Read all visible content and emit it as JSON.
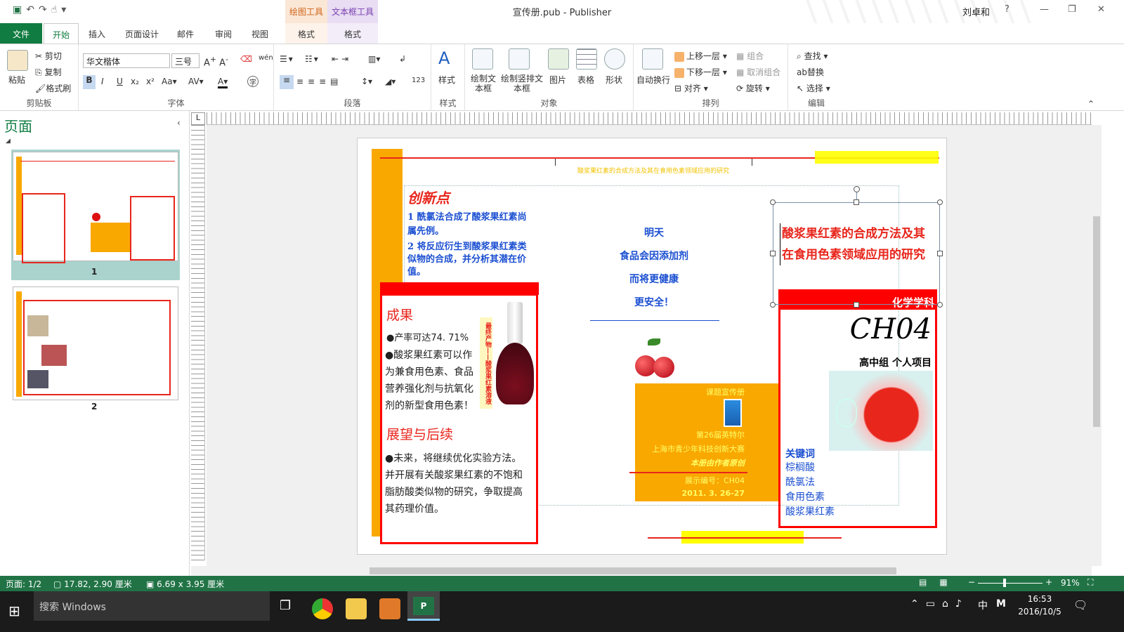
{
  "window": {
    "title": "宣传册.pub - Publisher",
    "user": "刘卓和",
    "help": "?"
  },
  "context_tabs": {
    "drawing_tools": "绘图工具",
    "textbox_tools": "文本框工具"
  },
  "tabs": [
    "文件",
    "开始",
    "插入",
    "页面设计",
    "邮件",
    "审阅",
    "视图",
    "格式",
    "格式"
  ],
  "ribbon": {
    "clipboard": {
      "label": "剪贴板",
      "paste": "粘贴",
      "cut": "剪切",
      "copy": "复制",
      "format_painter": "格式刷"
    },
    "font": {
      "label": "字体",
      "font_name": "华文楷体",
      "font_size": "三号"
    },
    "paragraph": {
      "label": "段落"
    },
    "styles": {
      "label": "样式",
      "styles_btn": "样式"
    },
    "objects": {
      "label": "对象",
      "draw_textbox": "绘制文本框",
      "draw_vtextbox": "绘制竖排文本框",
      "picture": "图片",
      "table": "表格",
      "shape": "形状"
    },
    "arrange": {
      "label": "排列",
      "wrap": "自动换行",
      "bring_forward": "上移一层",
      "send_backward": "下移一层",
      "align": "对齐",
      "group": "组合",
      "ungroup": "取消组合",
      "rotate": "旋转"
    },
    "editing": {
      "label": "编辑",
      "find": "查找",
      "replace": "替换",
      "select": "选择"
    }
  },
  "pages_pane": {
    "title": "页面",
    "pages": [
      "1",
      "2"
    ]
  },
  "doc": {
    "header_text": "酸浆果红素的合成方法及其在食用色素领域应用的研究",
    "innovation_title": "创新点",
    "innovation_1": "1 酰氯法合成了酸浆果红素尚属先例。",
    "innovation_2": "2 将反应衍生到酸浆果红素类似物的合成，并分析其潜在价值。",
    "result_title": "成果",
    "result_1": "●产率可达74. 71%",
    "result_2": "●酸浆果红素可以作为兼食用色素、食品营养强化剂与抗氧化剂的新型食用色素！",
    "vertical_label": "最终产物——酸浆果红素溶液",
    "outlook_title": "展望与后续",
    "outlook_1": "●未来，将继续优化实验方法。并开展有关酸浆果红素的不饱和脂肪酸类似物的研究，争取提高其药理价值。",
    "slogan": [
      "明天",
      "食品会因添加剂",
      "而将更健康",
      "更安全！"
    ],
    "promo": {
      "title": "课题宣传册",
      "line1": "第26届英特尔",
      "line2": "上海市青少年科技创新大赛",
      "line3": "本册由作者原创",
      "line4": "展示编号：CH04",
      "line5": "2011. 3. 26-27"
    },
    "cover_title": "酸浆果红素的合成方法及其在食用色素领域应用的研究",
    "subject": "化学学科",
    "code": "CH04",
    "group": "高中组 个人项目",
    "keywords_title": "关键词",
    "keywords": [
      "棕榈酸",
      "酰氯法",
      "食用色素",
      "酸浆果红素"
    ]
  },
  "status": {
    "page": "页面: 1/2",
    "position": "17.82, 2.90 厘米",
    "size": "6.69 x 3.95 厘米",
    "zoom": "91%"
  },
  "taskbar": {
    "search": "搜索 Windows",
    "time": "16:53",
    "date": "2016/10/5",
    "ime": "中"
  },
  "colors": {
    "accent_green": "#217346",
    "doc_red": "#e8261c",
    "doc_orange": "#f9a800",
    "doc_yellow": "#ffff00",
    "doc_blue": "#1b4fd1"
  }
}
